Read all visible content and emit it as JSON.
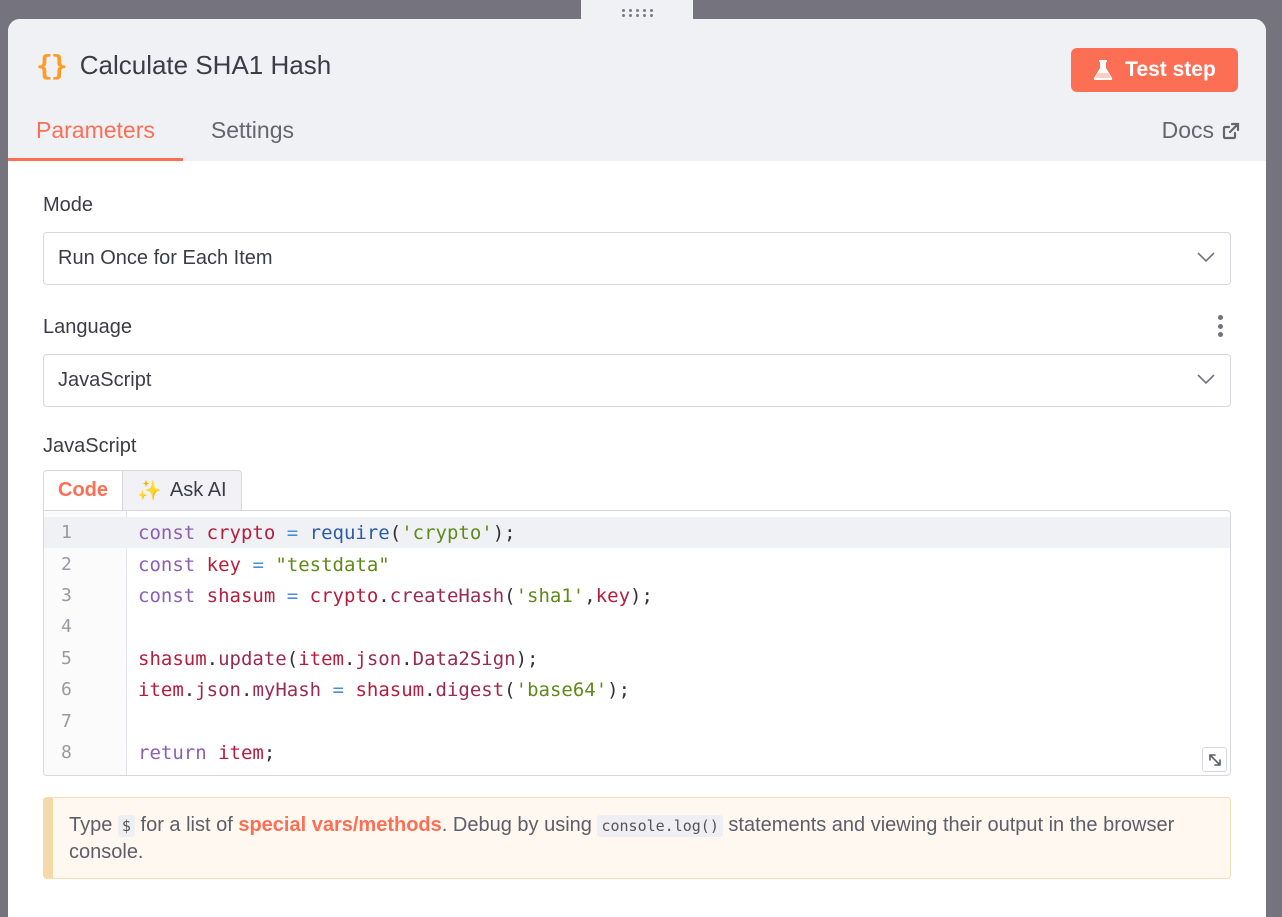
{
  "panel": {
    "title": "Calculate SHA1 Hash",
    "node_icon": "{}",
    "test_button": "Test step",
    "tabs": [
      {
        "label": "Parameters",
        "active": true
      },
      {
        "label": "Settings",
        "active": false
      }
    ],
    "docs_label": "Docs"
  },
  "mode": {
    "label": "Mode",
    "value": "Run Once for Each Item"
  },
  "language": {
    "label": "Language",
    "value": "JavaScript"
  },
  "code_field": {
    "label": "JavaScript",
    "tabs": {
      "code": "Code",
      "ask_ai": "Ask AI",
      "ask_ai_icon": "✨"
    },
    "line_numbers": [
      "1",
      "2",
      "3",
      "4",
      "5",
      "6",
      "7",
      "8"
    ],
    "lines": [
      "const crypto = require('crypto');",
      "const key = \"testdata\"",
      "const shasum = crypto.createHash('sha1',key);",
      "",
      "shasum.update(item.json.Data2Sign);",
      "item.json.myHash = shasum.digest('base64');",
      "",
      "return item;"
    ],
    "tokens": {
      "const": "const",
      "return": "return",
      "crypto": "crypto",
      "key": "key",
      "shasum": "shasum",
      "require": "require",
      "s_crypto": "'crypto'",
      "s_testdata": "\"testdata\"",
      "createHash": "createHash",
      "s_sha1": "'sha1'",
      "update": "update",
      "item": "item",
      "json": "json",
      "Data2Sign": "Data2Sign",
      "myHash": "myHash",
      "digest": "digest",
      "s_base64": "'base64'"
    }
  },
  "notice": {
    "prefix": "Type",
    "dollar": "$",
    "mid": "for a list of",
    "link": "special vars/methods",
    "mid2": ". Debug by using",
    "console_code": "console.log()",
    "suffix": "statements and viewing their output in the browser console."
  },
  "colors": {
    "accent": "#fd6f55",
    "icon_orange": "#ff9b26"
  }
}
